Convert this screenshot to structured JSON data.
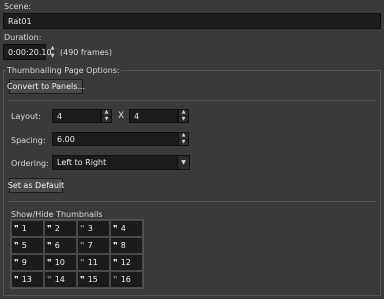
{
  "scene": {
    "label": "Scene:",
    "value": "Rat01"
  },
  "duration": {
    "label": "Duration:",
    "value": "0:00:20.10",
    "frames": "(490 frames)"
  },
  "options": {
    "title": "Thumbnailing Page Options:",
    "convert_label": "Convert to Panels...",
    "layout_label": "Layout:",
    "layout_cols": "4",
    "layout_x": "X",
    "layout_rows": "4",
    "spacing_label": "Spacing:",
    "spacing_value": "6.00",
    "ordering_label": "Ordering:",
    "ordering_value": "Left to Right",
    "default_label": "Set as Default"
  },
  "thumbs": {
    "title": "Show/Hide Thumbnails",
    "items": [
      {
        "n": "1",
        "visible": true
      },
      {
        "n": "2",
        "visible": true
      },
      {
        "n": "3",
        "visible": false
      },
      {
        "n": "4",
        "visible": true
      },
      {
        "n": "5",
        "visible": true
      },
      {
        "n": "6",
        "visible": true
      },
      {
        "n": "7",
        "visible": false
      },
      {
        "n": "8",
        "visible": true
      },
      {
        "n": "9",
        "visible": true
      },
      {
        "n": "10",
        "visible": true
      },
      {
        "n": "11",
        "visible": false
      },
      {
        "n": "12",
        "visible": true
      },
      {
        "n": "13",
        "visible": true
      },
      {
        "n": "14",
        "visible": false
      },
      {
        "n": "15",
        "visible": true
      },
      {
        "n": "16",
        "visible": false
      }
    ]
  }
}
